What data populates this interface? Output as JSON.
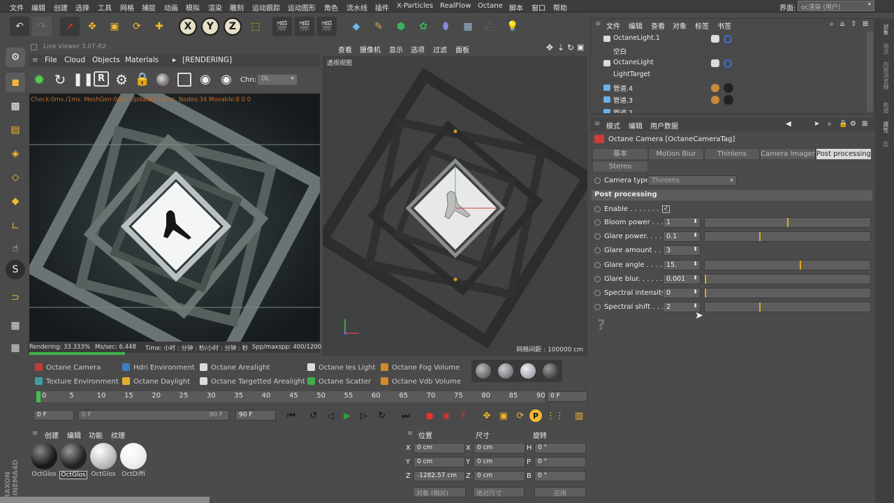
{
  "menubar": {
    "items": [
      "文件",
      "编辑",
      "创建",
      "选择",
      "工具",
      "网格",
      "捕捉",
      "动画",
      "模拟",
      "渲染",
      "雕刻",
      "运动跟踪",
      "运动图形",
      "角色",
      "流水线",
      "插件",
      "X-Particles",
      "RealFlow",
      "Octane",
      "脚本",
      "窗口",
      "帮助"
    ],
    "layout_label": "界面:",
    "layout_value": "oc渲染 (用户)"
  },
  "toolbar": {
    "axis_x": "X",
    "axis_y": "Y",
    "axis_z": "Z"
  },
  "live_viewer": {
    "title": "Live Viewer 3.07-R2",
    "menu": [
      "File",
      "Cloud",
      "Objects",
      "Materials"
    ],
    "rendering_tag": "[RENDERING]",
    "chn_label": "Chn:",
    "chn_value": "DL",
    "status": "Check:0ms./1ms. MeshGen:0ms. Update[C]:0ms. Nodes:34 Movable:8  0 0",
    "foot": {
      "rendering": "Rendering: 33.333%",
      "mssec": "Ms/sec: 6.448",
      "time": "Time: 小时 : 分钟 : 秒/小时 : 分钟 : 秒",
      "spp": "Spp/maxspp: 400/1200"
    },
    "progress": 0.33
  },
  "viewport": {
    "menu": [
      "查看",
      "摄像机",
      "显示",
      "选项",
      "过滤",
      "面板"
    ],
    "label": "透视视图",
    "grid": "网格间距 : 100000 cm"
  },
  "object_manager": {
    "menu": [
      "文件",
      "编辑",
      "查看",
      "对象",
      "标签",
      "书签"
    ],
    "rows": [
      {
        "name": "OctaneLight.1"
      },
      {
        "name": "空白"
      },
      {
        "name": "OctaneLight"
      },
      {
        "name": "LightTarget"
      },
      {
        "name": "管道.4"
      },
      {
        "name": "管道.3"
      },
      {
        "name": "管道.2"
      }
    ]
  },
  "attributes": {
    "menu": [
      "模式",
      "编辑",
      "用户数据"
    ],
    "title": "Octane Camera [OctaneCameraTag]",
    "tabs": [
      "基本",
      "Motion Blur",
      "Thinlens",
      "Camera Imager",
      "Post processing",
      "Stereo"
    ],
    "active_tab": "Post processing",
    "camera_type_label": "Camera type",
    "camera_type_value": "Thinlens",
    "section": "Post processing",
    "enable_label": "Enable . . . . . . . . .",
    "enable_value": "✓",
    "params": [
      {
        "label": "Bloom power . . . .",
        "value": "1",
        "slider": 0.5
      },
      {
        "label": "Glare power. . . . .",
        "value": "0.1",
        "slider": 0.33
      },
      {
        "label": "Glare amount . . . .",
        "value": "3"
      },
      {
        "label": "Glare angle . . . . .",
        "value": "15.",
        "slider": 0.58
      },
      {
        "label": "Glare blur. . . . . . .",
        "value": "0.001",
        "slider": 0.0
      },
      {
        "label": "Spectral intensity",
        "value": "0",
        "slider": 0.0
      },
      {
        "label": "Spectral shift . . . .",
        "value": "2",
        "slider": 0.33
      }
    ],
    "help_icon": "?"
  },
  "right_tabs": [
    "对象",
    "场次",
    "内容浏览器",
    "构造",
    "属性",
    "层"
  ],
  "object_bar": [
    {
      "label": "Octane Camera",
      "color": "#c23a3a"
    },
    {
      "label": "Hdri Environment",
      "color": "#3c7fc2"
    },
    {
      "label": "Octane Arealight",
      "color": "#dcdcdc"
    },
    {
      "label": "Octane Ies Light",
      "color": "#dcdcdc"
    },
    {
      "label": "Octane Fog Volume",
      "color": "#d28a2a"
    },
    {
      "label": "Texture Environment",
      "color": "#3fa0a0"
    },
    {
      "label": "Octane Daylight",
      "color": "#e0b030"
    },
    {
      "label": "Octane Targetted Arealight",
      "color": "#dcdcdc"
    },
    {
      "label": "Octane Scatter",
      "color": "#3fae4a"
    },
    {
      "label": "Octane Vdb Volume",
      "color": "#d28a2a"
    }
  ],
  "timeline": {
    "ticks": [
      "0",
      "5",
      "10",
      "15",
      "20",
      "25",
      "30",
      "35",
      "40",
      "45",
      "50",
      "55",
      "60",
      "65",
      "70",
      "75",
      "80",
      "85",
      "90"
    ],
    "current_frame": "0 F"
  },
  "transport": {
    "start": "0 F",
    "range_start": "0 F",
    "range_end": "90 F",
    "end": "90 F"
  },
  "materials": {
    "menu": [
      "创建",
      "编辑",
      "功能",
      "纹理"
    ],
    "items": [
      "OctGlos",
      "OctGlos",
      "OctGlos",
      "OctDiffi"
    ]
  },
  "coordinates": {
    "headers": [
      "位置",
      "尺寸",
      "旋转"
    ],
    "pos": {
      "x": "0 cm",
      "y": "0 cm",
      "z": "-1282.57 cm"
    },
    "size": {
      "x": "0 cm",
      "y": "0 cm",
      "z": "0 cm"
    },
    "rot": {
      "h": "0 °",
      "p": "0 °",
      "b": "0 °"
    },
    "mode": "对象 (相对)",
    "size_mode": "绝对尺寸",
    "apply": "应用"
  }
}
